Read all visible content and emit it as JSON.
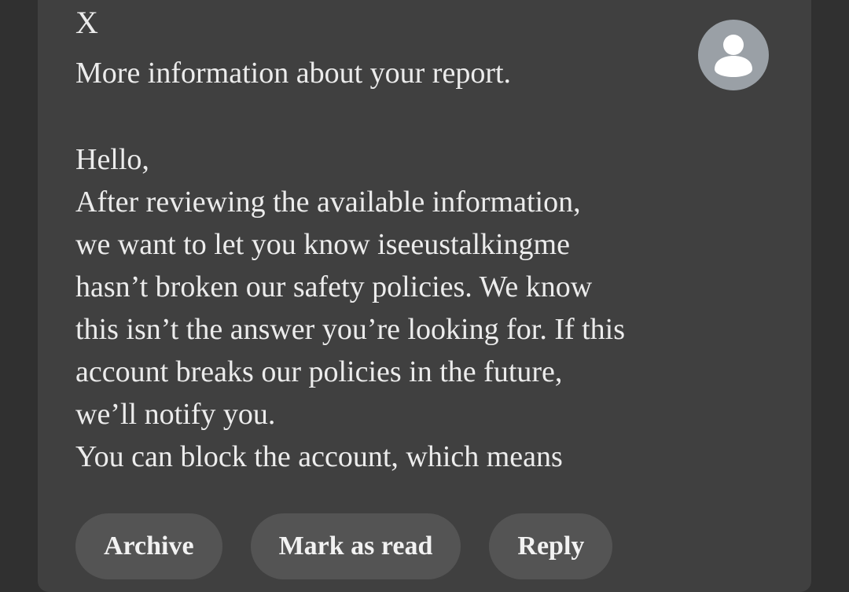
{
  "email": {
    "sender": "X",
    "subject": "More information about your report.",
    "avatar_icon": "person-icon",
    "body_lines": [
      "Hello,",
      "After reviewing the available information,",
      "we want to let you know iseeustalkingme",
      "hasn’t broken our safety policies. We know",
      "this isn’t the answer you’re looking for. If this",
      "account breaks our policies in the future,",
      "we’ll notify you.",
      "You can block the account, which means"
    ]
  },
  "actions": {
    "archive_label": "Archive",
    "mark_read_label": "Mark as read",
    "reply_label": "Reply"
  },
  "colors": {
    "background": "#303030",
    "card": "#404040",
    "pill": "#545454",
    "text": "#ececec",
    "avatar": "#9aa0a6"
  }
}
